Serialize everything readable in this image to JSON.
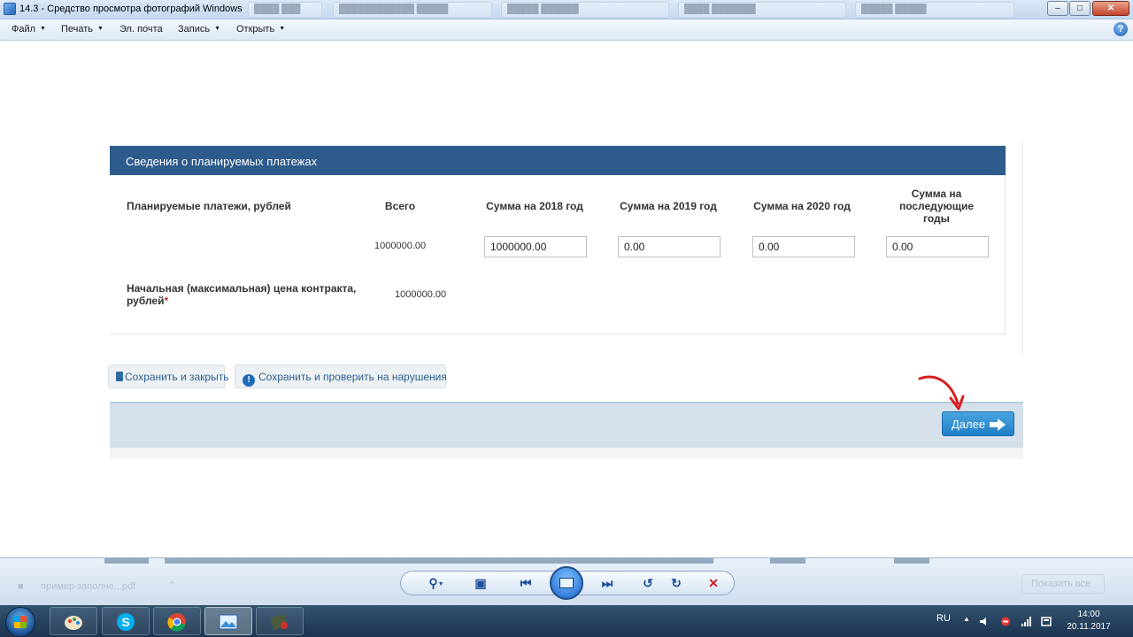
{
  "window": {
    "title": "14.3 - Средство просмотра фотографий Windows"
  },
  "menu": {
    "file": "Файл",
    "print": "Печать",
    "email": "Эл. почта",
    "burn": "Запись",
    "open": "Открыть",
    "help_glyph": "?"
  },
  "form": {
    "section_title": "Сведения о планируемых платежах",
    "columns": {
      "label": "Планируемые платежи, рублей",
      "total": "Всего",
      "y2018": "Сумма на 2018 год",
      "y2019": "Сумма на 2019 год",
      "y2020": "Сумма на 2020 год",
      "later_line1": "Сумма на",
      "later_line2": "последующие",
      "later_line3": "годы"
    },
    "payments_row": {
      "total": "1000000.00",
      "y2018": "1000000.00",
      "y2019": "0.00",
      "y2020": "0.00",
      "later": "0.00"
    },
    "price_row": {
      "label_line1": "Начальная (максимальная) цена контракта,",
      "label_line2": "рублей",
      "required_mark": "*",
      "value": "1000000.00"
    }
  },
  "actions": {
    "save_close": "Сохранить и закрыть",
    "save_check": "Сохранить и проверить на нарушения",
    "next": "Далее"
  },
  "viewer": {
    "ghost_file": "пример заполне...pdf",
    "ghost_button": "Показать все"
  },
  "taskbar": {
    "language": "RU",
    "time": "14:00",
    "date": "20.11.2017"
  },
  "colors": {
    "header_blue": "#2d5b8c",
    "next_button": "#2a8ad4",
    "annotation_arrow": "#d62020"
  }
}
